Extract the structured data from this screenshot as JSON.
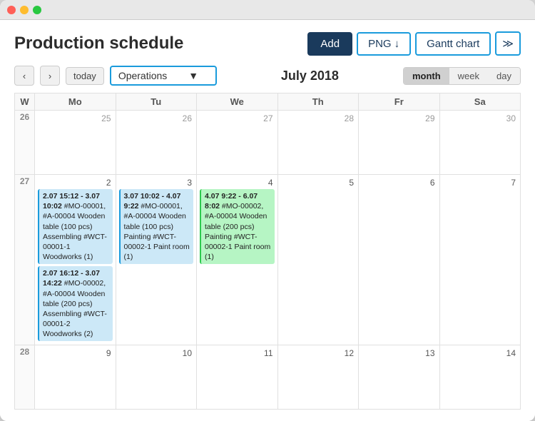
{
  "titlebar": {
    "close": "close",
    "minimize": "minimize",
    "maximize": "maximize"
  },
  "header": {
    "title": "Production schedule",
    "btn_add": "Add",
    "btn_png": "PNG",
    "btn_gantt": "Gantt chart",
    "btn_more": "⋮"
  },
  "controls": {
    "today": "today",
    "operations_label": "Operations",
    "month_label": "July 2018",
    "view_month": "month",
    "view_week": "week",
    "view_day": "day"
  },
  "calendar": {
    "columns": [
      "W",
      "Mo",
      "Tu",
      "We",
      "Th",
      "Fr",
      "Sa"
    ],
    "rows": [
      {
        "week": "26",
        "days": [
          {
            "num": "25",
            "current": false,
            "events": []
          },
          {
            "num": "26",
            "current": false,
            "events": []
          },
          {
            "num": "27",
            "current": false,
            "events": []
          },
          {
            "num": "28",
            "current": false,
            "events": []
          },
          {
            "num": "29",
            "current": false,
            "events": []
          },
          {
            "num": "30",
            "current": false,
            "events": []
          }
        ]
      },
      {
        "week": "27",
        "days": [
          {
            "num": "2",
            "current": true,
            "events": [
              {
                "type": "blue",
                "text": "2.07 15:12 - 3.07 10:02 #MO-00001, #A-00004 Wooden table (100 pcs) Assembling #WCT-00001-1 Woodworks (1)"
              },
              {
                "type": "blue",
                "text": "2.07 16:12 - 3.07 14:22 #MO-00002, #A-00004 Wooden table (200 pcs) Assembling #WCT-00001-2 Woodworks (2)"
              }
            ]
          },
          {
            "num": "3",
            "current": true,
            "events": [
              {
                "type": "blue",
                "text": "3.07 10:02 - 4.07 9:22 #MO-00001, #A-00004 Wooden table (100 pcs) Painting #WCT-00002-1 Paint room (1)"
              }
            ]
          },
          {
            "num": "4",
            "current": true,
            "events": [
              {
                "type": "green",
                "text": "4.07 9:22 - 6.07 8:02 #MO-00002, #A-00004 Wooden table (200 pcs) Painting #WCT-00002-1 Paint room (1)"
              }
            ]
          },
          {
            "num": "5",
            "current": true,
            "events": []
          },
          {
            "num": "6",
            "current": true,
            "events": []
          },
          {
            "num": "7",
            "current": true,
            "events": []
          }
        ]
      },
      {
        "week": "28",
        "days": [
          {
            "num": "9",
            "current": true,
            "events": []
          },
          {
            "num": "10",
            "current": true,
            "events": []
          },
          {
            "num": "11",
            "current": true,
            "events": []
          },
          {
            "num": "12",
            "current": true,
            "events": []
          },
          {
            "num": "13",
            "current": true,
            "events": []
          },
          {
            "num": "14",
            "current": true,
            "events": []
          }
        ]
      }
    ]
  }
}
